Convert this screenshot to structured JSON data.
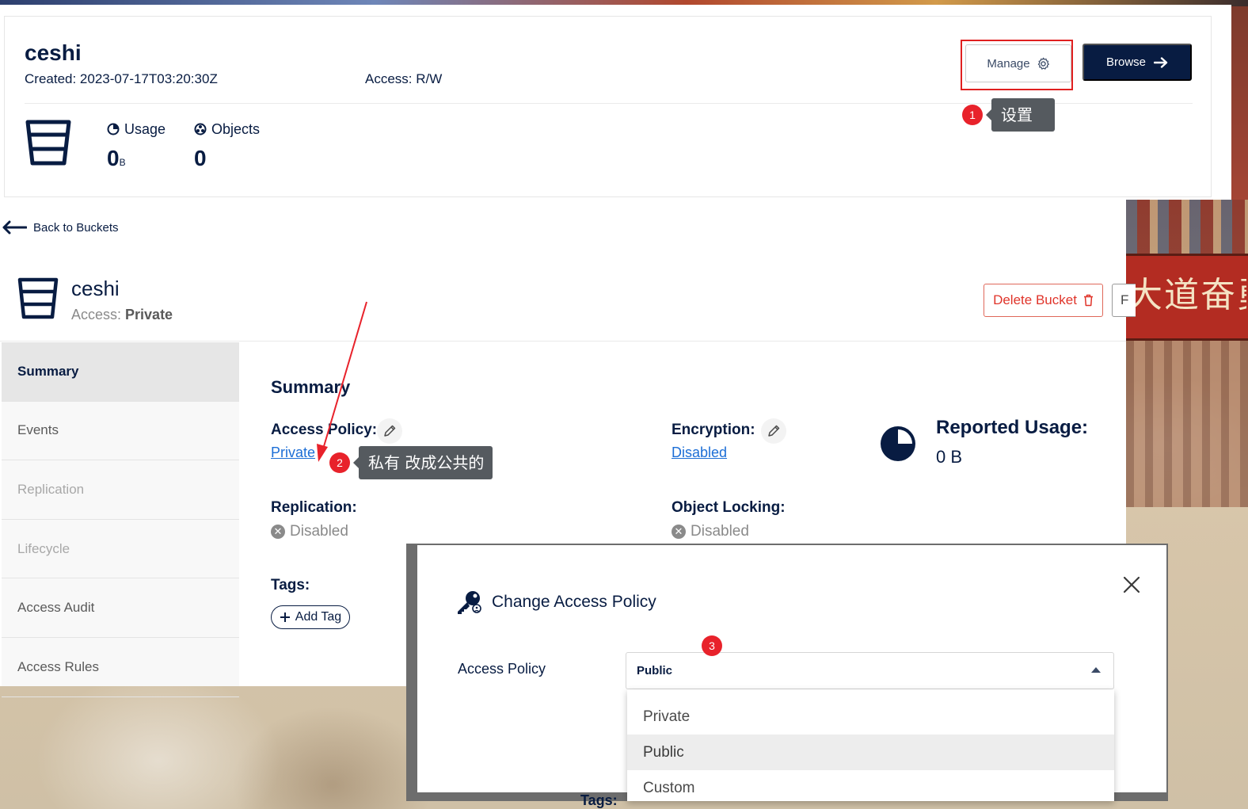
{
  "top_card": {
    "bucket_name": "ceshi",
    "created": "Created: 2023-07-17T03:20:30Z",
    "access": "Access: R/W",
    "usage_label": "Usage",
    "usage_value": "0",
    "usage_unit": "B",
    "objects_label": "Objects",
    "objects_value": "0",
    "manage_label": "Manage",
    "browse_label": "Browse"
  },
  "annotations": [
    {
      "number": "1",
      "text": "设置"
    },
    {
      "number": "2",
      "text": "私有 改成公共的"
    },
    {
      "number": "3"
    }
  ],
  "detail": {
    "back_label": "Back to Buckets",
    "bucket_name": "ceshi",
    "access_prefix": "Access: ",
    "access_value": "Private",
    "delete_label": "Delete Bucket",
    "next_button_fragment": "F",
    "sidenav": [
      {
        "label": "Summary",
        "state": "active"
      },
      {
        "label": "Events",
        "state": "enabled"
      },
      {
        "label": "Replication",
        "state": "disabled"
      },
      {
        "label": "Lifecycle",
        "state": "disabled"
      },
      {
        "label": "Access Audit",
        "state": "enabled"
      },
      {
        "label": "Access Rules",
        "state": "enabled"
      }
    ],
    "summary": {
      "heading": "Summary",
      "access_policy_label": "Access Policy:",
      "access_policy_value": "Private",
      "encryption_label": "Encryption:",
      "encryption_value": "Disabled",
      "reported_usage_label": "Reported Usage:",
      "reported_usage_value": "0 B",
      "replication_label": "Replication:",
      "replication_value": "Disabled",
      "object_locking_label": "Object Locking:",
      "object_locking_value": "Disabled",
      "tags_label": "Tags:",
      "add_tag_label": "Add Tag"
    }
  },
  "modal": {
    "title": "Change Access Policy",
    "field_label": "Access Policy",
    "selected_value": "Public",
    "options": [
      "Private",
      "Public",
      "Custom"
    ],
    "highlighted_option": "Public",
    "partial_text_below": "Tags:"
  },
  "colors": {
    "navy": "#081c42",
    "danger": "#e0342a",
    "link": "#1c6ed6",
    "annotation_red": "#e8222b",
    "tooltip_gray": "#555a5f"
  },
  "background_sign_text": "大道奋勇前"
}
